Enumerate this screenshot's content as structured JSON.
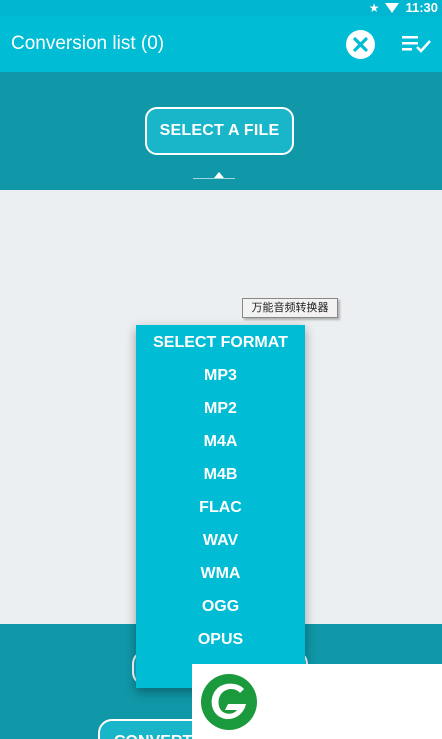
{
  "status_bar": {
    "time": "11:30",
    "icons": [
      "star-icon",
      "wifi-icon"
    ]
  },
  "app_bar": {
    "title": "Conversion list (0)",
    "actions": [
      "clear-list-icon",
      "select-list-icon"
    ]
  },
  "header": {
    "select_file_label": "SELECT A FILE"
  },
  "tooltip": {
    "text": "万能音频转换器"
  },
  "format_menu": {
    "items": [
      "SELECT FORMAT",
      "MP3",
      "MP2",
      "M4A",
      "M4B",
      "FLAC",
      "WAV",
      "WMA",
      "OGG",
      "OPUS"
    ]
  },
  "footer": {
    "convert_label": "CONVERT"
  },
  "colors": {
    "primary": "#00bcd4",
    "panel": "#1097a8",
    "background": "#eceff1",
    "logo_green": "#1a9a3c"
  }
}
